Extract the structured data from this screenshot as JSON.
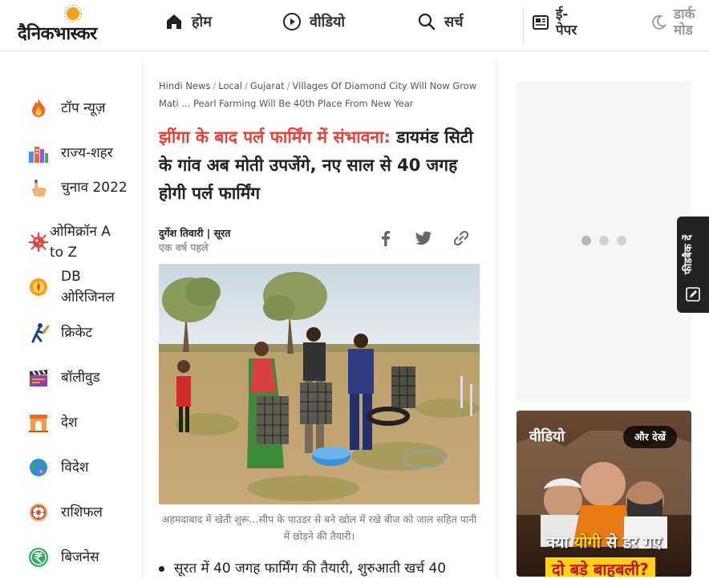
{
  "header": {
    "logo_text": "दैनिकभास्कर",
    "nav": {
      "home": "होम",
      "video": "वीडियो",
      "search": "सर्च",
      "epaper": "ई-पेपर",
      "dark_mode": "डार्क मोड"
    }
  },
  "sidebar": {
    "items": [
      {
        "label": "टॉप न्यूज़",
        "icon": "fire-icon"
      },
      {
        "label": "राज्य-शहर",
        "icon": "city-icon"
      },
      {
        "label": "चुनाव 2022",
        "icon": "voting-finger-icon"
      },
      {
        "label": "ओमिक्रॉन A to Z",
        "icon": "virus-icon"
      },
      {
        "label": "DB ओरिजिनल",
        "icon": "db-original-icon"
      },
      {
        "label": "क्रिकेट",
        "icon": "cricket-icon"
      },
      {
        "label": "बॉलीवुड",
        "icon": "clapperboard-icon"
      },
      {
        "label": "देश",
        "icon": "india-gate-icon"
      },
      {
        "label": "विदेश",
        "icon": "globe-icon"
      },
      {
        "label": "राशिफल",
        "icon": "zodiac-icon"
      },
      {
        "label": "बिजनेस",
        "icon": "rupee-icon"
      }
    ]
  },
  "article": {
    "breadcrumb": [
      "Hindi News",
      "Local",
      "Gujarat",
      "Villages Of Diamond City Will Now Grow Mati ... Pearl Farming Will Be 40th Place From New Year"
    ],
    "headline_kicker": "झींगा के बाद पर्ल फार्मिंग में संभावना:",
    "headline_rest": " डायमंड सिटी के गांव अब मोती उपजेंगे, नए साल से 40 जगह होगी पर्ल फार्मिंग",
    "author": "दुर्गेश तिवारी | सूरत",
    "time": "एक वर्ष पहले",
    "caption": "अहमदाबाद में खेती शुरू...सीप के पाउडर से बने खोल में रखे बीज को जाल सहित पानी में छोड़ने की तैयारी।",
    "bullet": "सूरत में 40 जगह फार्मिंग की तैयारी, शुरुआती खर्च 40"
  },
  "right": {
    "video_label": "वीडियो",
    "video_more": "और देखें",
    "video_title_line1_a": "क्या ",
    "video_title_line1_b": "योगी",
    "video_title_line1_c": " से डर गए",
    "video_title_line2": "दो बड़े बाहुबली?",
    "feedback": "फीडबैक दें"
  },
  "colors": {
    "accent_red": "#e5433c",
    "logo_sun": "#f5a01a",
    "highlight_yellow": "#ffd21a"
  }
}
